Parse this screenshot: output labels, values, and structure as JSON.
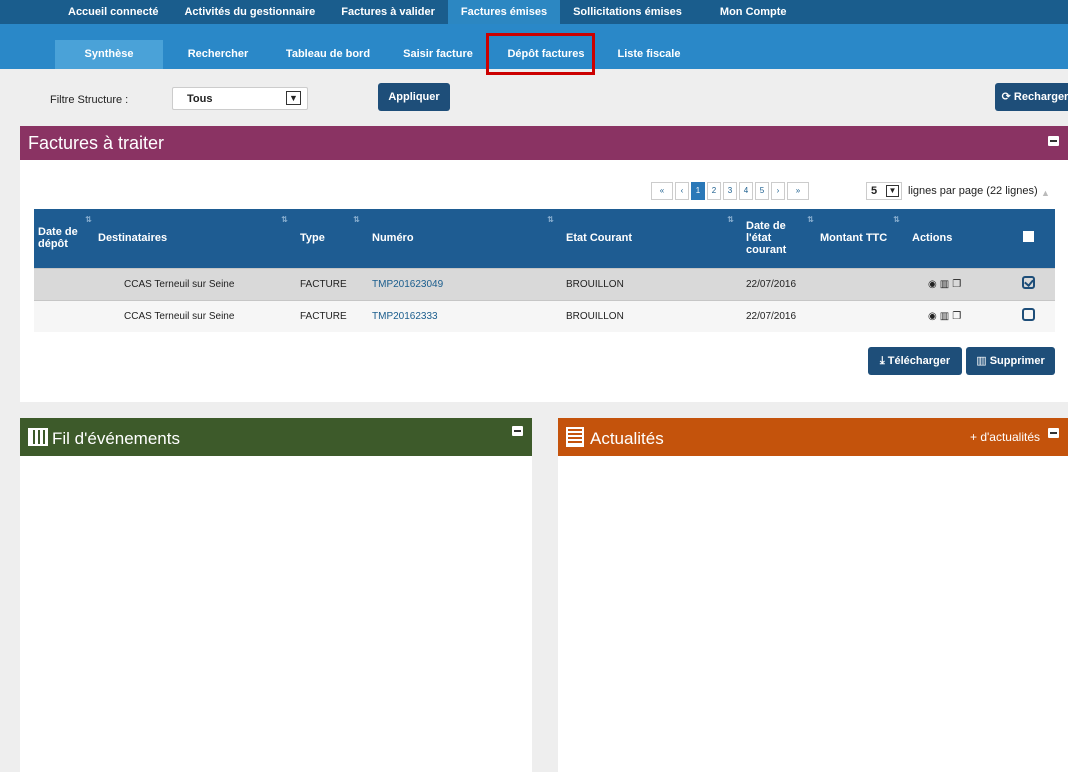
{
  "nav_top": [
    "Accueil connecté",
    "Activités du gestionnaire",
    "Factures à valider",
    "Factures émises",
    "Sollicitations émises",
    "Mon Compte"
  ],
  "nav_sub": [
    "Synthèse",
    "Rechercher",
    "Tableau de bord",
    "Saisir facture",
    "Dépôt factures",
    "Liste fiscale"
  ],
  "filter": {
    "label": "Filtre Structure :",
    "value": "Tous",
    "apply": "Appliquer",
    "reload": "Recharger"
  },
  "invoices_panel": {
    "title": "Factures à traiter",
    "pages": [
      "1",
      "2",
      "3",
      "4",
      "5"
    ],
    "per_page_value": "5",
    "per_page_text": "lignes par page (22 lignes)",
    "columns": [
      "Date de dépôt",
      "Destinataires",
      "Type",
      "Numéro",
      "Etat Courant",
      "Date de l'état courant",
      "Montant TTC",
      "Actions"
    ],
    "rows": [
      {
        "date_depot": "",
        "destinataire": "CCAS Terneuil sur Seine",
        "type": "FACTURE",
        "numero": "TMP201623049",
        "etat": "BROUILLON",
        "date_etat": "22/07/2016",
        "montant": "",
        "checked": true
      },
      {
        "date_depot": "",
        "destinataire": "CCAS Terneuil sur Seine",
        "type": "FACTURE",
        "numero": "TMP20162333",
        "etat": "BROUILLON",
        "date_etat": "22/07/2016",
        "montant": "",
        "checked": false
      }
    ],
    "download": "Télécharger",
    "delete": "Supprimer"
  },
  "events_panel": {
    "title": "Fil d'événements"
  },
  "news_panel": {
    "title": "Actualités",
    "more": "+ d'actualités"
  }
}
